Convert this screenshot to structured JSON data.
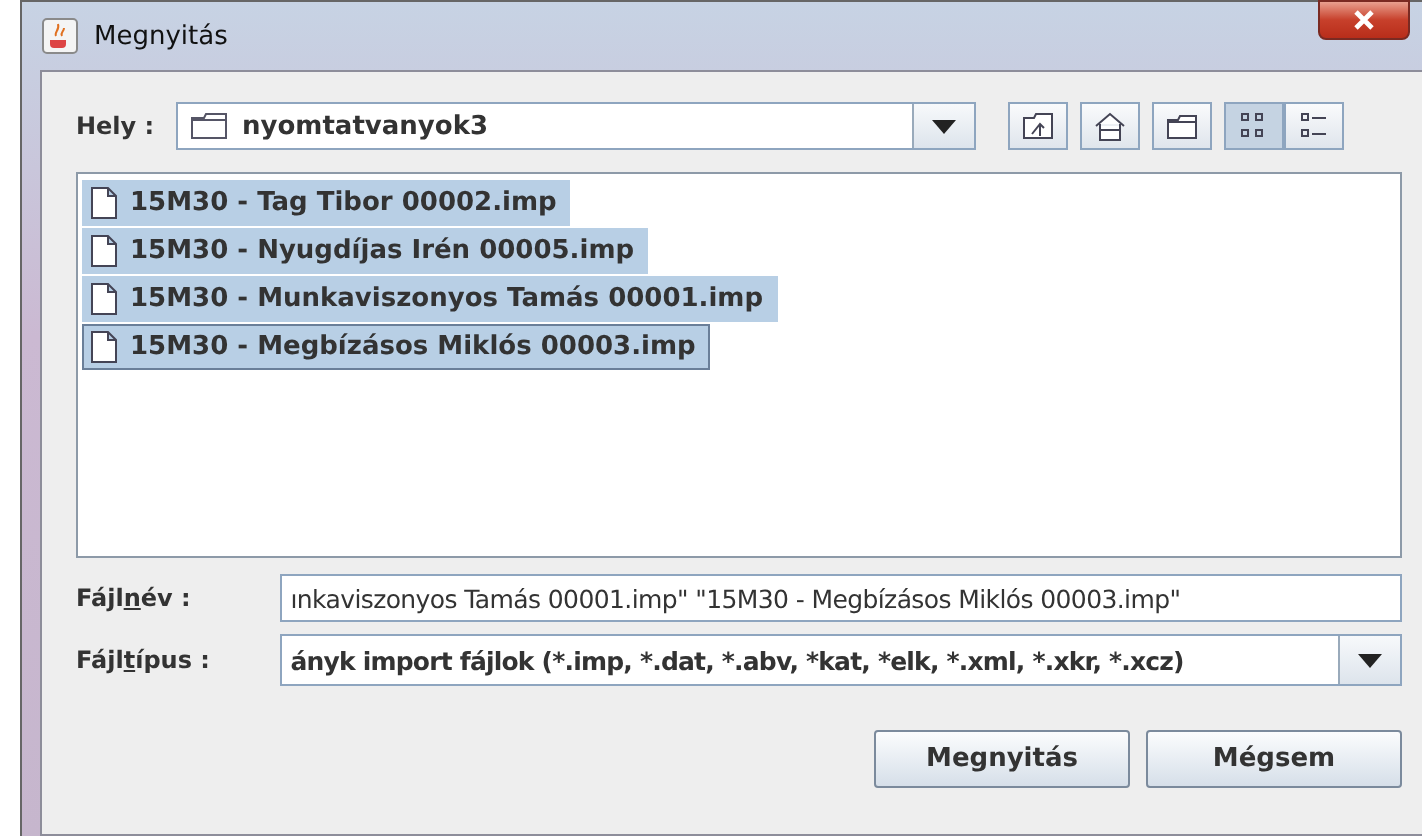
{
  "window": {
    "title": "Megnyitás"
  },
  "location": {
    "label": "Hely :",
    "value": "nyomtatvanyok3"
  },
  "toolbar": [
    {
      "kind": "up",
      "selected": false
    },
    {
      "kind": "home",
      "selected": false
    },
    {
      "kind": "newfolder",
      "selected": false
    },
    {
      "kind": "list",
      "selected": true
    },
    {
      "kind": "details",
      "selected": false
    }
  ],
  "files": [
    {
      "name": "15M30 - Tag Tibor 00002.imp",
      "selected": true,
      "focused": false
    },
    {
      "name": "15M30 - Nyugdíjas Irén 00005.imp",
      "selected": true,
      "focused": false
    },
    {
      "name": "15M30 - Munkaviszonyos Tamás 00001.imp",
      "selected": true,
      "focused": false
    },
    {
      "name": "15M30 - Megbízásos Miklós 00003.imp",
      "selected": true,
      "focused": true
    }
  ],
  "filename": {
    "label": {
      "before": "Fájl",
      "key": "n",
      "after": "év :"
    },
    "value": "ınkaviszonyos Tamás 00001.imp\" \"15M30 - Megbízásos Miklós 00003.imp\""
  },
  "filetype": {
    "label": {
      "before": "Fájl",
      "key": "t",
      "after": "ípus :"
    },
    "value": "ányk import fájlok (*.imp, *.dat, *.abv, *kat, *elk, *.xml, *.xkr, *.xcz)"
  },
  "buttons": [
    "Megnyitás",
    "Mégsem"
  ]
}
